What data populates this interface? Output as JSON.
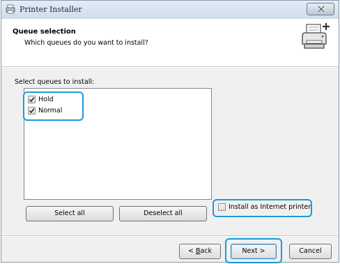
{
  "window": {
    "title": "Printer Installer"
  },
  "header": {
    "title": "Queue selection",
    "subtitle": "Which queues do you want to install?"
  },
  "queues": {
    "label": "Select queues to install:",
    "items": [
      {
        "label": "Hold",
        "checked": true
      },
      {
        "label": "Normal",
        "checked": true
      }
    ]
  },
  "buttons": {
    "select_all": "Select all",
    "deselect_all": "Deselect all",
    "back_prefix": "< ",
    "back_accel": "B",
    "back_rest": "ack",
    "next": "Next >",
    "cancel": "Cancel"
  },
  "internet_option": {
    "label": "Install as Internet printer",
    "checked": false
  },
  "colors": {
    "highlight": "#1a9bd8",
    "accent": "#3c7fb1"
  }
}
